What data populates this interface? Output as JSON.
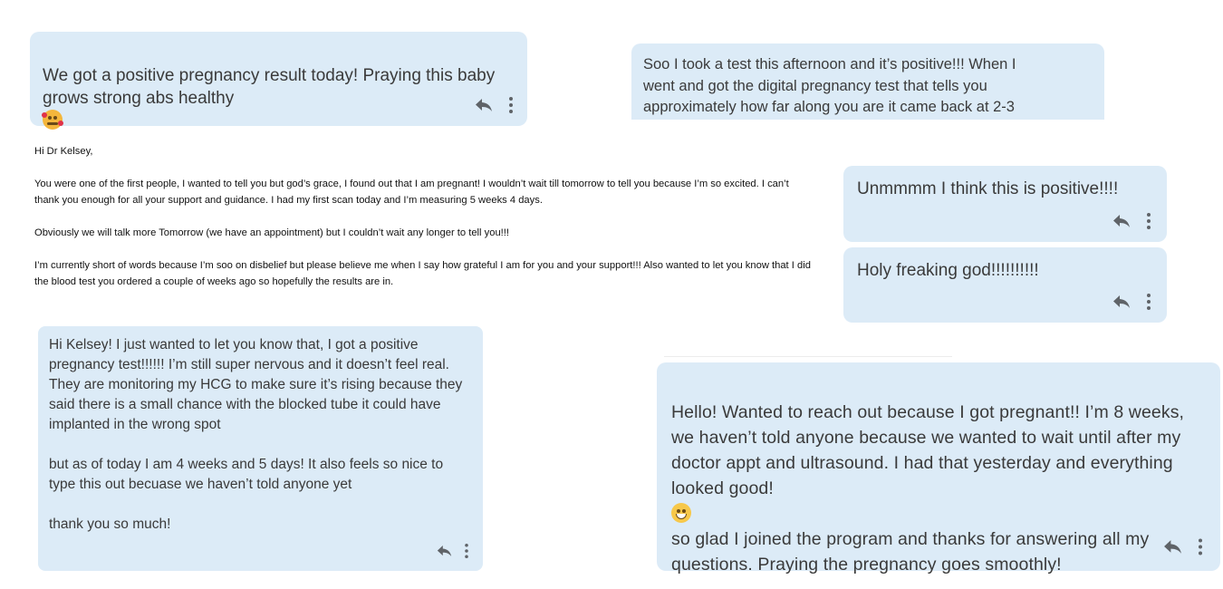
{
  "msg1": {
    "text": "We got a positive pregnancy result today! Praying this baby\ngrows strong abs healthy",
    "emoji": "smiling-face-with-hearts"
  },
  "msg2": {
    "text": "Soo I took a test this afternoon and it’s positive!!! When I\nwent and got the digital pregnancy test that tells you\napproximately how far along you are it came back at 2-3"
  },
  "letter": {
    "greeting": "Hi Dr Kelsey,",
    "p1": "You were one of the first people, I wanted to tell you but god’s grace, I found out that I am pregnant! I wouldn’t wait till tomorrow to tell you because I’m so excited. I can’t thank you enough for all your support and guidance. I had my first scan today and I’m measuring 5 weeks 4 days.",
    "p2": "Obviously we will talk more Tomorrow (we have an appointment) but I couldn’t wait any longer to tell you!!!",
    "p3": "I’m currently short of words because I’m soo on disbelief but please believe me when I say how grateful I am for you and your support!!! Also wanted to let you know that I did the blood test you ordered a couple of weeks ago so hopefully the results are in."
  },
  "msg3": {
    "text": "Unmmmm I think this is positive!!!!"
  },
  "msg4": {
    "text": "Holy freaking god!!!!!!!!!!"
  },
  "msg5": {
    "p1": "Hi Kelsey! I just wanted to let you know that, I got a positive pregnancy test!!!!!! I’m still super nervous and it doesn’t feel real. They are monitoring my HCG to make sure it’s rising because they said there is a small chance with the blocked tube it could have implanted in the wrong spot",
    "p2": "but as of today I am 4 weeks and 5 days! It also feels so nice to type this out becuase we haven’t told anyone yet",
    "p3": "thank you so much!"
  },
  "msg6": {
    "text_a": "Hello! Wanted to reach out because I got pregnant!! I’m 8 weeks, we haven’t told anyone because we wanted to wait until after my doctor appt and ultrasound. I had that yesterday and everything looked good!",
    "emoji": "grinning-face",
    "text_b": "so glad I joined the program and thanks for answering all my questions. Praying the pregnancy goes smoothly!"
  },
  "colors": {
    "bubble": "#dcebf7",
    "text": "#3a3a3a",
    "icon": "#5f6368"
  }
}
